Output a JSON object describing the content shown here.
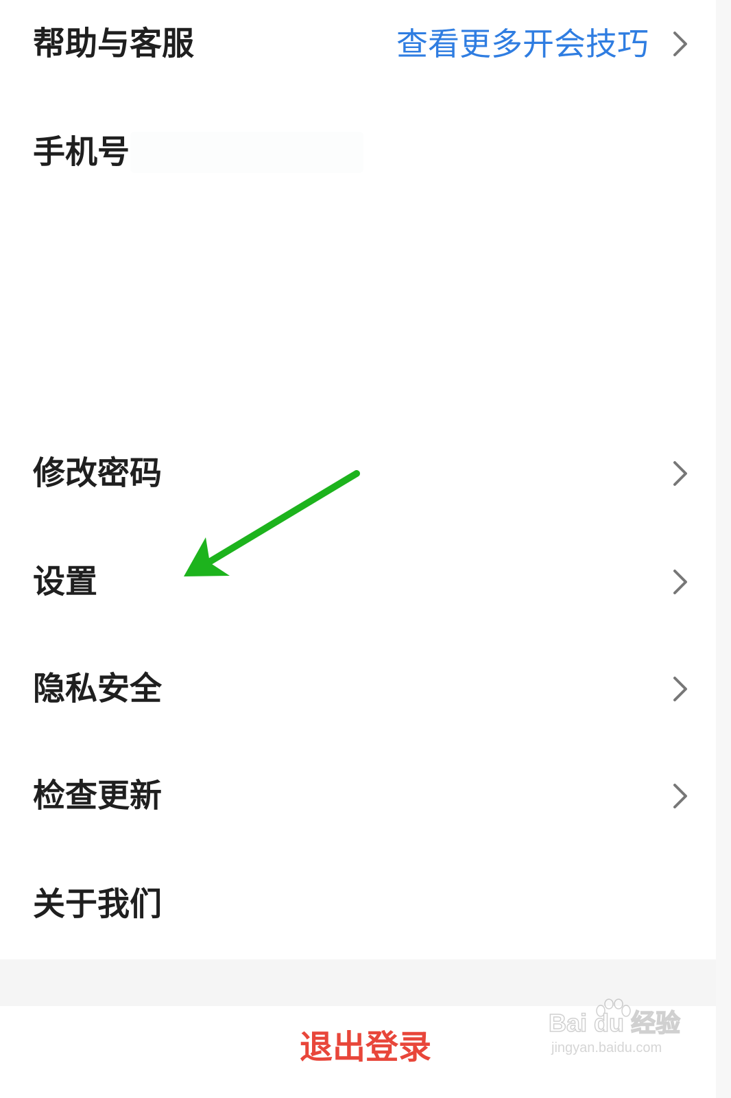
{
  "menu": {
    "help": {
      "label": "帮助与客服",
      "link": "查看更多开会技巧"
    },
    "phone": {
      "label": "手机号"
    },
    "change_password": {
      "label": "修改密码"
    },
    "settings": {
      "label": "设置"
    },
    "privacy": {
      "label": "隐私安全"
    },
    "check_update": {
      "label": "检查更新"
    },
    "about": {
      "label": "关于我们"
    }
  },
  "logout": {
    "label": "退出登录"
  },
  "watermark": {
    "brand": "Bai du 经验",
    "url": "jingyan.baidu.com"
  },
  "colors": {
    "link": "#2f7de1",
    "logout": "#e8463a",
    "annotation_arrow": "#1db31d",
    "chevron": "#777777"
  },
  "icons": {
    "row_chevron": "chevron-right-icon",
    "annotation": "arrow-annotation",
    "watermark_logo": "baidu-paw-icon"
  }
}
